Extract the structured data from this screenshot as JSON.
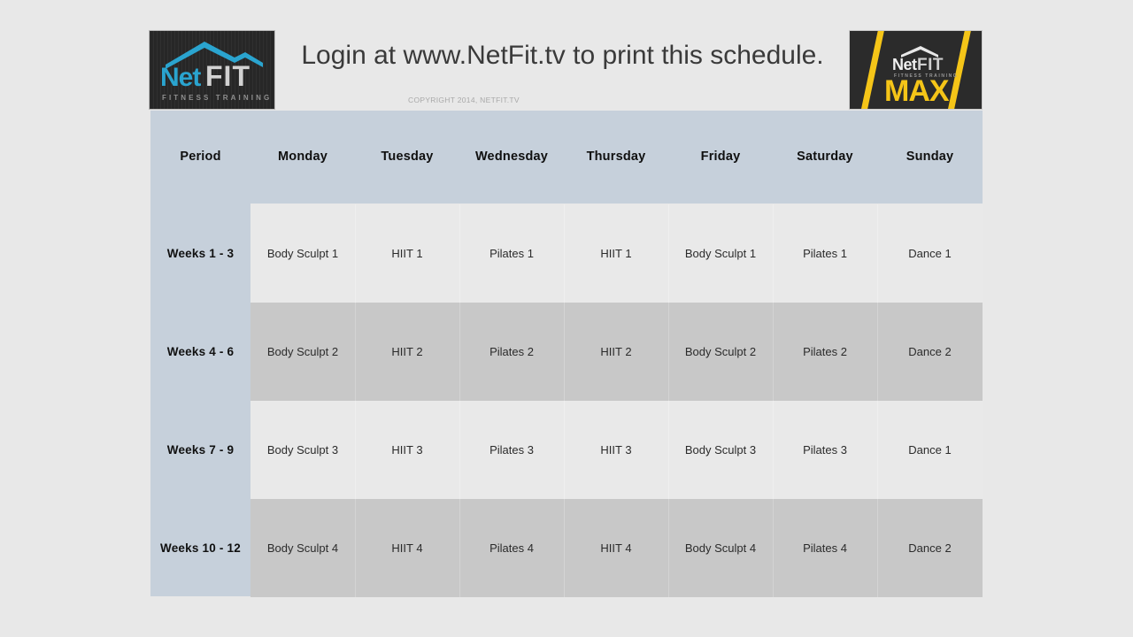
{
  "header": {
    "headline": "Login at www.NetFit.tv to print this schedule.",
    "copyright": "COPYRIGHT 2014, NETFIT.TV",
    "brand_logo": {
      "name_part1": "Net",
      "name_part2": "FIT",
      "tagline": "FITNESS TRAINING",
      "accent_color": "#2aa4cf",
      "background_color": "#272727"
    },
    "max_logo": {
      "name_part1": "Net",
      "name_part2": "FIT",
      "tagline": "FITNESS TRAINING",
      "word": "MAX",
      "accent_color": "#f5c518",
      "background_color": "#2b2b2b"
    }
  },
  "colors": {
    "page_background": "#e8e8e8",
    "header_band": "#c6d0db",
    "row_light": "#e9e9e9",
    "row_dark": "#c8c8c8",
    "text_dark": "#101010"
  },
  "schedule": {
    "columns": [
      "Period",
      "Monday",
      "Tuesday",
      "Wednesday",
      "Thursday",
      "Friday",
      "Saturday",
      "Sunday"
    ],
    "rows": [
      {
        "period": "Weeks 1 - 3",
        "shade": "light",
        "cells": [
          "Body Sculpt 1",
          "HIIT 1",
          "Pilates 1",
          "HIIT 1",
          "Body Sculpt 1",
          "Pilates 1",
          "Dance 1"
        ]
      },
      {
        "period": "Weeks 4 - 6",
        "shade": "dark",
        "cells": [
          "Body Sculpt 2",
          "HIIT 2",
          "Pilates 2",
          "HIIT 2",
          "Body Sculpt 2",
          "Pilates 2",
          "Dance 2"
        ]
      },
      {
        "period": "Weeks 7 - 9",
        "shade": "light",
        "cells": [
          "Body Sculpt 3",
          "HIIT 3",
          "Pilates 3",
          "HIIT 3",
          "Body Sculpt 3",
          "Pilates 3",
          "Dance 1"
        ]
      },
      {
        "period": "Weeks 10 - 12",
        "shade": "dark",
        "cells": [
          "Body Sculpt 4",
          "HIIT 4",
          "Pilates 4",
          "HIIT 4",
          "Body Sculpt 4",
          "Pilates 4",
          "Dance 2"
        ]
      }
    ]
  }
}
